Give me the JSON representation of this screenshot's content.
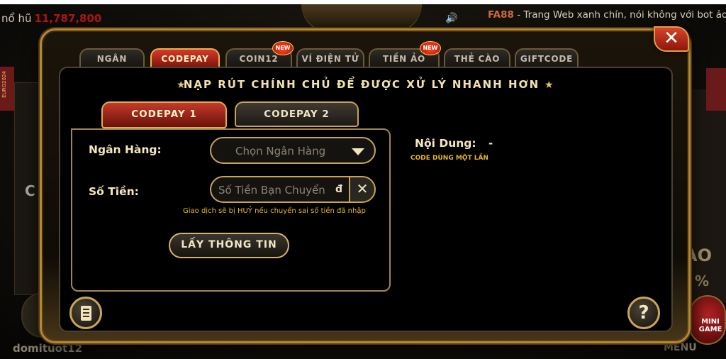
{
  "background": {
    "jackpot_label": "nổ hũ",
    "jackpot_value": "11,787,800",
    "marquee_brand": "FA88",
    "marquee_text": " - Trang Web xanh chín, nói không với bot ảo",
    "username": "domituot12",
    "menu_label": "MENU",
    "mini_game_label": "MINI GAME",
    "euro_badge": "EURO2024",
    "left_card_text": "C",
    "right_promo_text": "AO",
    "right_promo_pct": "%"
  },
  "tabs": [
    {
      "label": "NGÂN HÀNG",
      "active": false,
      "badge": ""
    },
    {
      "label": "CODEPAY",
      "active": true,
      "badge": ""
    },
    {
      "label": "COIN12",
      "active": false,
      "badge": "NEW"
    },
    {
      "label": "VÍ ĐIỆN TỬ",
      "active": false,
      "badge": ""
    },
    {
      "label": "TIỀN ẢO",
      "active": false,
      "badge": "NEW"
    },
    {
      "label": "THẺ CÀO",
      "active": false,
      "badge": ""
    },
    {
      "label": "GIFTCODE",
      "active": false,
      "badge": ""
    }
  ],
  "heading": "NẠP RÚT CHÍNH CHỦ ĐỂ ĐƯỢC XỬ LÝ NHANH HƠN",
  "subtabs": [
    {
      "label": "CODEPAY 1",
      "active": true
    },
    {
      "label": "CODEPAY 2",
      "active": false
    }
  ],
  "form": {
    "bank_label": "Ngân Hàng:",
    "bank_placeholder": "Chọn Ngân Hàng",
    "amount_label": "Số Tiền:",
    "amount_placeholder": "Số Tiền Bạn Chuyển",
    "currency_symbol": "đ",
    "clear_symbol": "✕",
    "warning": "Giao dịch sẽ bị HUỶ nếu chuyển sai số tiền đã nhập",
    "action_label": "LẤY THÔNG TIN"
  },
  "content": {
    "label": "Nội Dung:",
    "value": "-",
    "note": "CODE DÙNG MỘT LẦN"
  },
  "close_symbol": "✕",
  "help_symbol": "?",
  "colors": {
    "accent_gold": "#c9a458",
    "active_red": "#c5392a",
    "warning_yellow": "#e6b52a"
  }
}
